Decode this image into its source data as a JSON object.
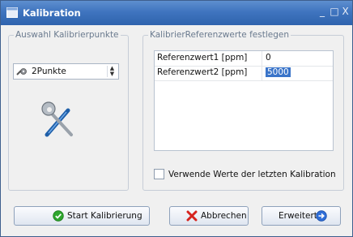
{
  "window": {
    "title": "Kalibration",
    "minimize_glyph": "_",
    "close_glyph": "□ X",
    "app_icon": "app-window-icon"
  },
  "left_group": {
    "legend": "Auswahl Kalibrierpunkte",
    "combo": {
      "value": "2Punkte",
      "icon": "wrench-gear-icon"
    },
    "tools_icon": "tools-icon"
  },
  "right_group": {
    "legend": "KalibrierReferenzwerte festlegen",
    "rows": [
      {
        "key": "Referenzwert1 [ppm]",
        "value": "0"
      },
      {
        "key": "Referenzwert2 [ppm]",
        "value": "5000"
      }
    ],
    "checkbox": {
      "label": "Verwende Werte der letzten Kalibration",
      "checked": false
    }
  },
  "buttons": {
    "start": {
      "label": "Start Kalibrierung",
      "icon": "green-circle-check-icon"
    },
    "cancel": {
      "label": "Abbrechen",
      "icon": "red-x-icon"
    },
    "advanced": {
      "label": "Erweitert",
      "icon": "blue-arrow-right-icon"
    }
  },
  "colors": {
    "titlebar": "#3f74bf",
    "selection": "#3a74c9",
    "start_icon": "#2ea62e",
    "cancel_icon": "#d6231e",
    "advanced_icon": "#2f6ed8"
  }
}
